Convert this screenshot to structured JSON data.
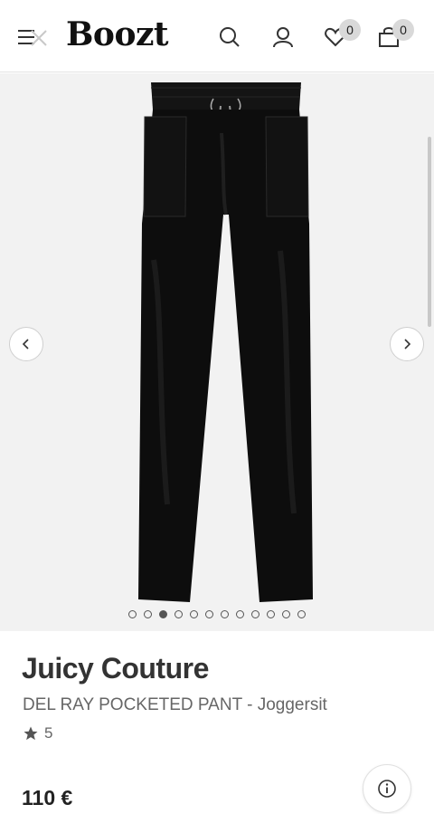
{
  "header": {
    "logo": "Boozt",
    "wishlist_count": "0",
    "cart_count": "0"
  },
  "icons": {
    "menu": "menu-icon",
    "search": "search-icon",
    "account": "user-icon",
    "wishlist": "heart-icon",
    "cart": "shopping-bag-icon",
    "prev": "chevron-left-icon",
    "next": "chevron-right-icon",
    "info": "info-icon",
    "rating": "star-icon"
  },
  "gallery": {
    "image_count": 12,
    "active_index": 2
  },
  "product": {
    "brand": "Juicy Couture",
    "name": "DEL RAY POCKETED PANT - Joggersit",
    "rating": "5",
    "price": "110 €"
  },
  "colors": {
    "badge": "#d9d9d9",
    "gallery_bg": "#f2f2f2",
    "product": "#111111"
  }
}
